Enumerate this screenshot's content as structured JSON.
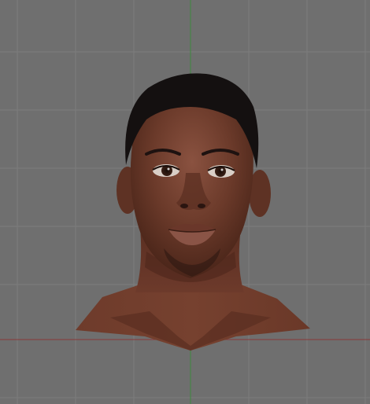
{
  "viewport": {
    "background_color": "#6f6f6f",
    "grid_color": "#7c7c7c",
    "x_axis_color": "#8a3a3a",
    "y_axis_color": "#3c8a3c",
    "model": "head-mesh",
    "skin_colors": {
      "base": "#6b3a2a",
      "shadow": "#3f1f16",
      "highlight": "#8a5240",
      "lip": "#7a4134",
      "hair": "#141010"
    }
  }
}
